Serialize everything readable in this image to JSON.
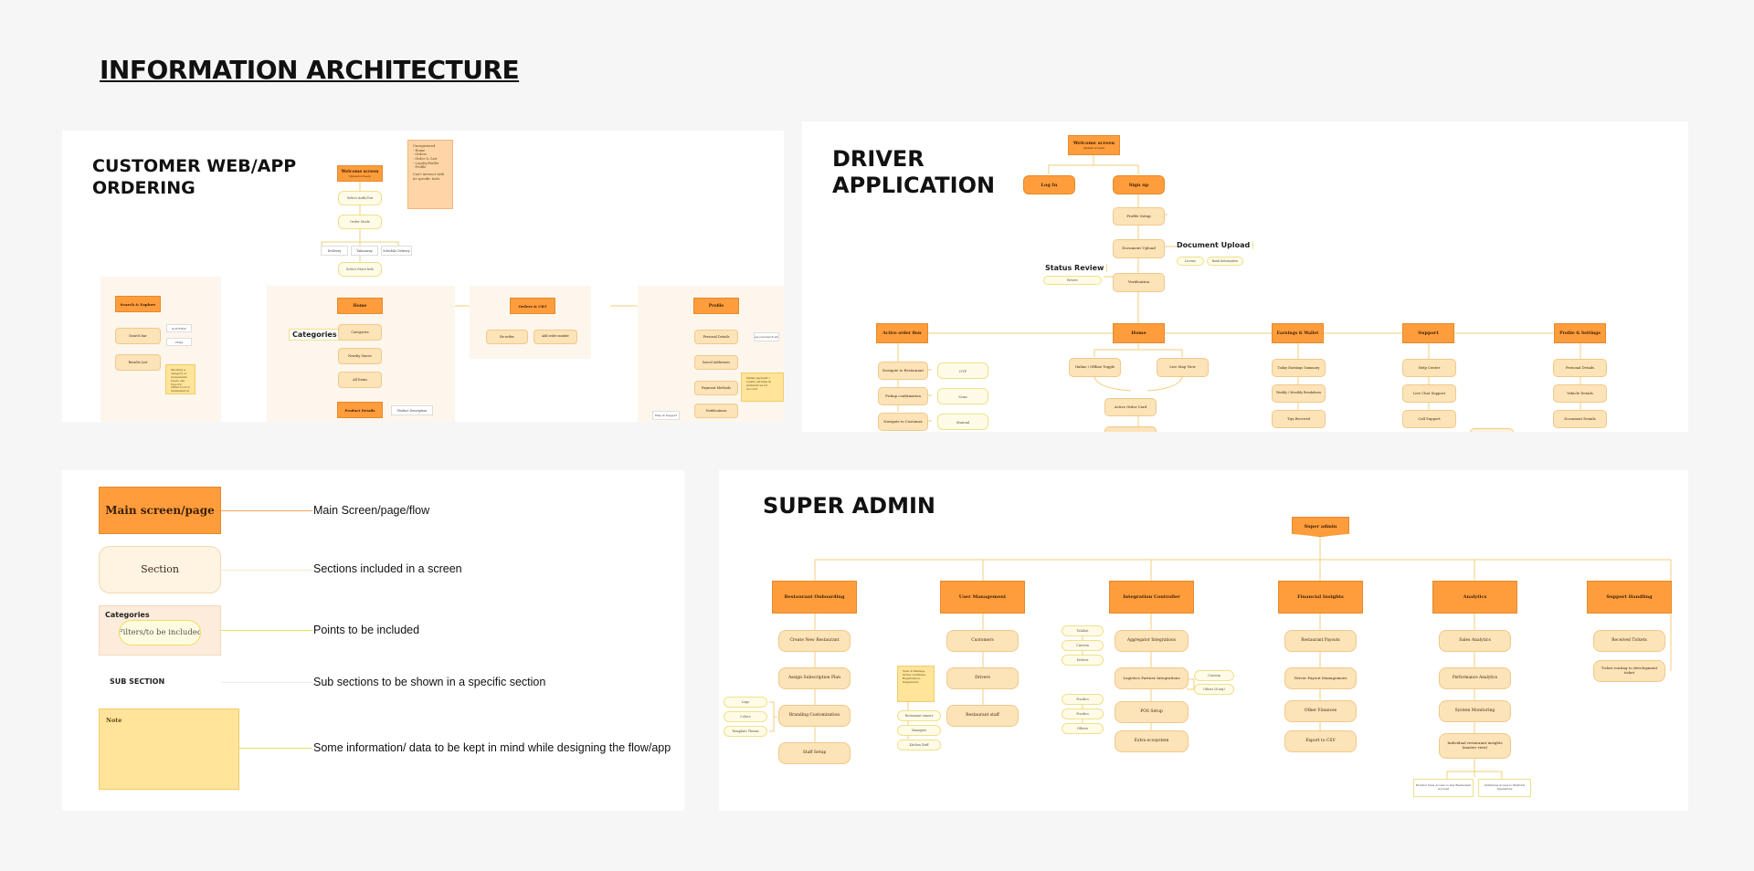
{
  "page_title": "INFORMATION ARCHITECTURE",
  "customer": {
    "title_line1": "CUSTOMER WEB/APP",
    "title_line2": "ORDERING",
    "welcome": "Welcome screen",
    "welcome_sub": "(Splash screen)",
    "guest_note_title": "Unregistered",
    "guest_note_items": [
      "- Home",
      "- Orders",
      "- Order & Cart",
      "- Loyalty/Wallet",
      "- Profile"
    ],
    "guest_note_footer": "Can't interact with its specific tools",
    "flow": [
      "Select Auth/Out",
      "Order Mode",
      "Select Store Info"
    ],
    "order_modes": [
      "Delivery",
      "Takeaway",
      "Schedule Delivery"
    ],
    "search": "Search & Explore",
    "search_bar": "Search bar",
    "search_options": [
      "Sort/Filter",
      "Chips"
    ],
    "results": "Results List",
    "search_note": "Showing a category of restaurants. Users can type for either food or restaurant by name.",
    "home": "Home",
    "categories_label": "Categories",
    "home_sections": [
      "Categories",
      "Nearby Stores",
      "All Items"
    ],
    "product": "Product Details",
    "product_desc": "Product Description",
    "orders": "Orders & CRT",
    "orders_options": [
      "Re-order",
      "Add order number"
    ],
    "profile": "Profile",
    "profile_sections": [
      "Personal Details",
      "Saved Addresses",
      "Payment Methods",
      "Notifications"
    ],
    "profile_side": "Manage personal & address",
    "profile_note": "Wallet payment / loyalty settings & preferences for account",
    "profile_bottom": "Help & Support"
  },
  "driver": {
    "title_line1": "DRIVER",
    "title_line2": "APPLICATION",
    "welcome": "Welcome screen",
    "welcome_sub": "(Splash screen)",
    "login": "Log In",
    "signup": "Sign up",
    "signup_flow": [
      "Profile Setup",
      "Document Upload",
      "Verification"
    ],
    "doc_upload_label": "Document Upload",
    "doc_items": [
      "License",
      "Bank Information"
    ],
    "status_label": "Status Review",
    "status_item": "Review",
    "active_flow": "Active order flow",
    "active_items": [
      "Navigate to Restaurant",
      "Pickup confirmation",
      "Navigate to Customer"
    ],
    "active_side": [
      "OTP",
      "Scan",
      "Manual"
    ],
    "home": "Home",
    "home_items": [
      "Online / Offline Toggle",
      "Live Map View",
      "Active Order Card"
    ],
    "earnings": "Earnings & Wallet",
    "earnings_items": [
      "Today Earnings Summary",
      "Weekly / Monthly Breakdown",
      "Tips Received"
    ],
    "support": "Support",
    "support_items": [
      "Help Center",
      "Live Chat Support",
      "Call Support"
    ],
    "profile": "Profile & Settings",
    "profile_items": [
      "Personal Details",
      "Vehicle Details",
      "Document Details"
    ]
  },
  "legend": {
    "main_label": "Main screen/page",
    "main_desc": "Main Screen/page/flow",
    "section_label": "Section",
    "section_desc": "Sections included in a screen",
    "categories_label": "Categories",
    "filters_label": "Filters/to be included",
    "points_desc": "Points to be included",
    "subsection_label": "SUB SECTION",
    "subsection_desc": "Sub sections to be shown in a specific section",
    "note_label": "Note",
    "note_desc": "Some information/ data to be kept in mind while designing the flow/app"
  },
  "admin": {
    "title": "SUPER ADMIN",
    "root": "Super admin",
    "columns": [
      {
        "title": "Restaurant Onboarding",
        "items": [
          "Create New Restaurant",
          "Assign Subscription Plan",
          "Branding Customization",
          "Staff Setup"
        ]
      },
      {
        "title": "User Management",
        "items": [
          "Customers",
          "Drivers",
          "Restaurant staff"
        ]
      },
      {
        "title": "Integration Controller",
        "items": [
          "Aggregator Integrations",
          "Logistics Partner Integrations",
          "POS Setup",
          "Extra ecosystem"
        ]
      },
      {
        "title": "Financial Insights",
        "items": [
          "Restaurant Payouts",
          "Driver Payout Management",
          "Other Finances",
          "Export to CSV"
        ]
      },
      {
        "title": "Analytics",
        "items": [
          "Sales Analytics",
          "Performance Analytics",
          "System Monitoring",
          "Individual restaurant insights (master view)"
        ]
      },
      {
        "title": "Support Handling",
        "items": [
          "Received Tickets",
          "Ticket routing to development ticket"
        ]
      }
    ],
    "onboarding_side": [
      "Logo",
      "Colors",
      "Template Theme"
    ],
    "users_note": "View & Manage Driver Activities, Registration, Suspension",
    "users_side": [
      "Restaurant owners",
      "Managers",
      "Kitchen Staff"
    ],
    "integration_side_top": [
      "Talabat",
      "Careem",
      "Deliver"
    ],
    "integration_side_bottom": [
      "Foodics",
      "Foodics",
      "Others"
    ],
    "integration_right": [
      "Careem",
      "Others (if any)"
    ],
    "analytics_sub": [
      "Monitor View Access to Any Restaurant Account",
      "Individual Access to Platform Operations"
    ]
  },
  "colors": {
    "main": "#ff9d3c",
    "section": "#fde3b8",
    "point": "#fffbe6",
    "note": "#ffe49a",
    "connector": "#f1cf7a"
  }
}
